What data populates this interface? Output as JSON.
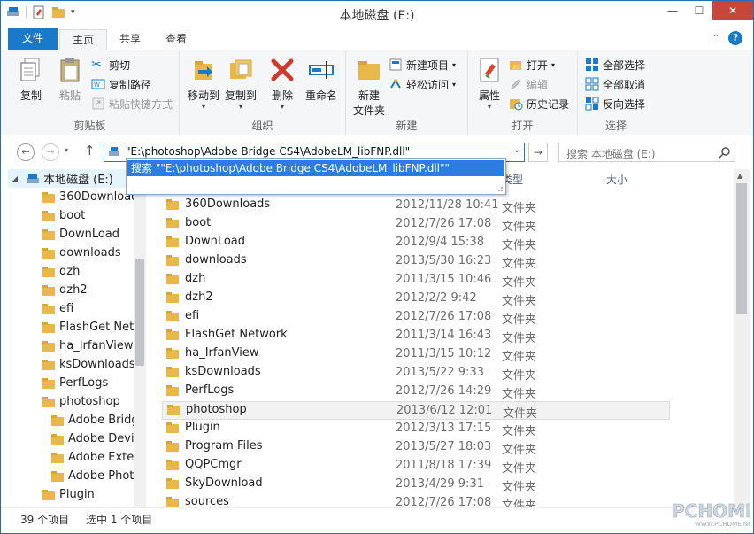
{
  "window": {
    "title": "本地磁盘 (E:)"
  },
  "ribbon_tabs": [
    {
      "label": "文件"
    },
    {
      "label": "主页"
    },
    {
      "label": "共享"
    },
    {
      "label": "查看"
    }
  ],
  "ribbon": {
    "clipboard": {
      "copy": "复制",
      "paste": "粘贴",
      "cut": "剪切",
      "copy_path": "复制路径",
      "paste_shortcut": "粘贴快捷方式",
      "group": "剪贴板"
    },
    "organize": {
      "move_to": "移动到",
      "copy_to": "复制到",
      "delete": "删除",
      "rename": "重命名",
      "group": "组织"
    },
    "new": {
      "new_folder_line1": "新建",
      "new_folder_line2": "文件夹",
      "new_item": "新建项目",
      "easy_access": "轻松访问",
      "group": "新建"
    },
    "open": {
      "properties": "属性",
      "open": "打开",
      "edit": "编辑",
      "history": "历史记录",
      "group": "打开"
    },
    "select": {
      "select_all": "全部选择",
      "select_none": "全部取消",
      "invert": "反向选择",
      "group": "选择"
    }
  },
  "address": {
    "value": "\"E:\\photoshop\\Adobe Bridge CS4\\AdobeLM_libFNP.dll\"",
    "suggestion": "搜索 \"\"E:\\photoshop\\Adobe Bridge CS4\\AdobeLM_libFNP.dll\"\""
  },
  "search": {
    "placeholder": "搜索 本地磁盘 (E:)"
  },
  "columns": {
    "type": "类型",
    "size": "大小"
  },
  "nav_tree": {
    "root": "本地磁盘 (E:)",
    "items": [
      {
        "label": "360Download",
        "indent": 0
      },
      {
        "label": "boot",
        "indent": 0
      },
      {
        "label": "DownLoad",
        "indent": 0
      },
      {
        "label": "downloads",
        "indent": 0
      },
      {
        "label": "dzh",
        "indent": 0
      },
      {
        "label": "dzh2",
        "indent": 0
      },
      {
        "label": "efi",
        "indent": 0
      },
      {
        "label": "FlashGet Netv",
        "indent": 0
      },
      {
        "label": "ha_IrfanView",
        "indent": 0
      },
      {
        "label": "ksDownloads",
        "indent": 0
      },
      {
        "label": "PerfLogs",
        "indent": 0
      },
      {
        "label": "photoshop",
        "indent": 0
      },
      {
        "label": "Adobe Bridg",
        "indent": 1
      },
      {
        "label": "Adobe Devi",
        "indent": 1
      },
      {
        "label": "Adobe Exter",
        "indent": 1
      },
      {
        "label": "Adobe Phot",
        "indent": 1
      },
      {
        "label": "Plugin",
        "indent": 0
      }
    ]
  },
  "files": [
    {
      "name": "360Downloads",
      "date": "2012/11/28 10:41",
      "type": "文件夹"
    },
    {
      "name": "boot",
      "date": "2012/7/26 17:08",
      "type": "文件夹"
    },
    {
      "name": "DownLoad",
      "date": "2012/9/4 15:38",
      "type": "文件夹"
    },
    {
      "name": "downloads",
      "date": "2013/5/30 16:23",
      "type": "文件夹"
    },
    {
      "name": "dzh",
      "date": "2011/3/15 10:46",
      "type": "文件夹"
    },
    {
      "name": "dzh2",
      "date": "2012/2/2 9:42",
      "type": "文件夹"
    },
    {
      "name": "efi",
      "date": "2012/7/26 17:08",
      "type": "文件夹"
    },
    {
      "name": "FlashGet Network",
      "date": "2011/3/14 16:43",
      "type": "文件夹"
    },
    {
      "name": "ha_IrfanView",
      "date": "2011/3/15 10:12",
      "type": "文件夹"
    },
    {
      "name": "ksDownloads",
      "date": "2013/5/22 9:33",
      "type": "文件夹"
    },
    {
      "name": "PerfLogs",
      "date": "2012/7/26 14:29",
      "type": "文件夹"
    },
    {
      "name": "photoshop",
      "date": "2013/6/12 12:01",
      "type": "文件夹",
      "selected": true
    },
    {
      "name": "Plugin",
      "date": "2012/3/13 17:15",
      "type": "文件夹"
    },
    {
      "name": "Program Files",
      "date": "2013/5/27 18:03",
      "type": "文件夹"
    },
    {
      "name": "QQPCmgr",
      "date": "2011/8/18 17:39",
      "type": "文件夹"
    },
    {
      "name": "SkyDownload",
      "date": "2013/4/29 9:31",
      "type": "文件夹"
    },
    {
      "name": "sources",
      "date": "2012/7/26 17:08",
      "type": "文件夹"
    }
  ],
  "status": {
    "count": "39 个项目",
    "selected": "选中 1 个项目"
  },
  "colors": {
    "accent": "#1979ca",
    "folder": "#e8b84a",
    "selection": "#2b7de1"
  }
}
